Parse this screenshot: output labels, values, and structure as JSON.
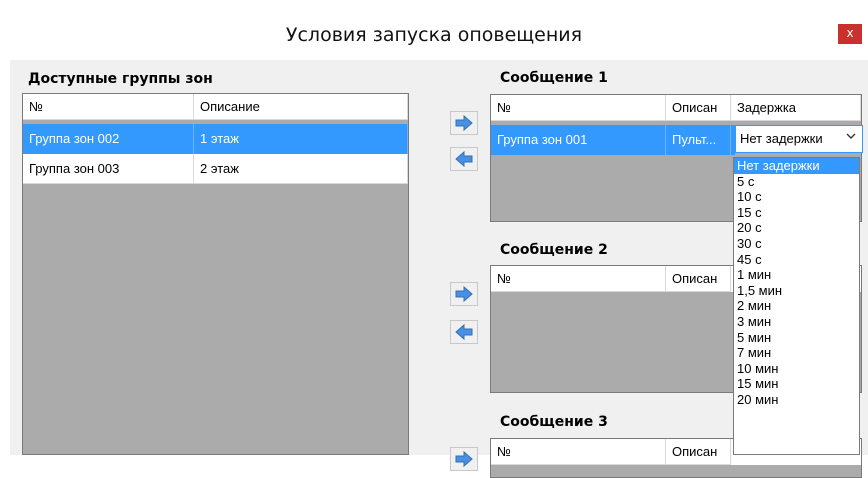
{
  "window": {
    "title": "Условия запуска оповещения",
    "close_glyph": "x"
  },
  "available": {
    "label": "Доступные группы зон",
    "columns": [
      "№",
      "Описание"
    ],
    "rows": [
      {
        "num": "Группа зон 002",
        "desc": "1 этаж",
        "selected": true
      },
      {
        "num": "Группа зон 003",
        "desc": "2 этаж",
        "selected": false
      }
    ]
  },
  "message1": {
    "label": "Сообщение 1",
    "columns": [
      "№",
      "Описан",
      "Задержка"
    ],
    "rows": [
      {
        "num": "Группа зон 001",
        "desc": "Пульт...",
        "delay": "Нет задержки"
      }
    ]
  },
  "message2": {
    "label": "Сообщение 2",
    "columns": [
      "№",
      "Описан"
    ]
  },
  "message3": {
    "label": "Сообщение 3",
    "columns": [
      "№",
      "Описан"
    ]
  },
  "delay_options": [
    "Нет задержки",
    "5 с",
    "10 с",
    "15 с",
    "20 с",
    "30 с",
    "45 с",
    "1 мин",
    "1,5 мин",
    "2 мин",
    "3 мин",
    "5 мин",
    "7 мин",
    "10 мин",
    "15 мин",
    "20 мин"
  ],
  "delay_selected_index": 0,
  "icons": {
    "add": "arrow-right-icon",
    "remove": "arrow-left-icon",
    "dropdown": "chevron-down-icon"
  },
  "colors": {
    "selection": "#3399ff",
    "grid_background": "#ababab",
    "close_button": "#c9312c",
    "arrow_fill": "#4a90e2"
  }
}
